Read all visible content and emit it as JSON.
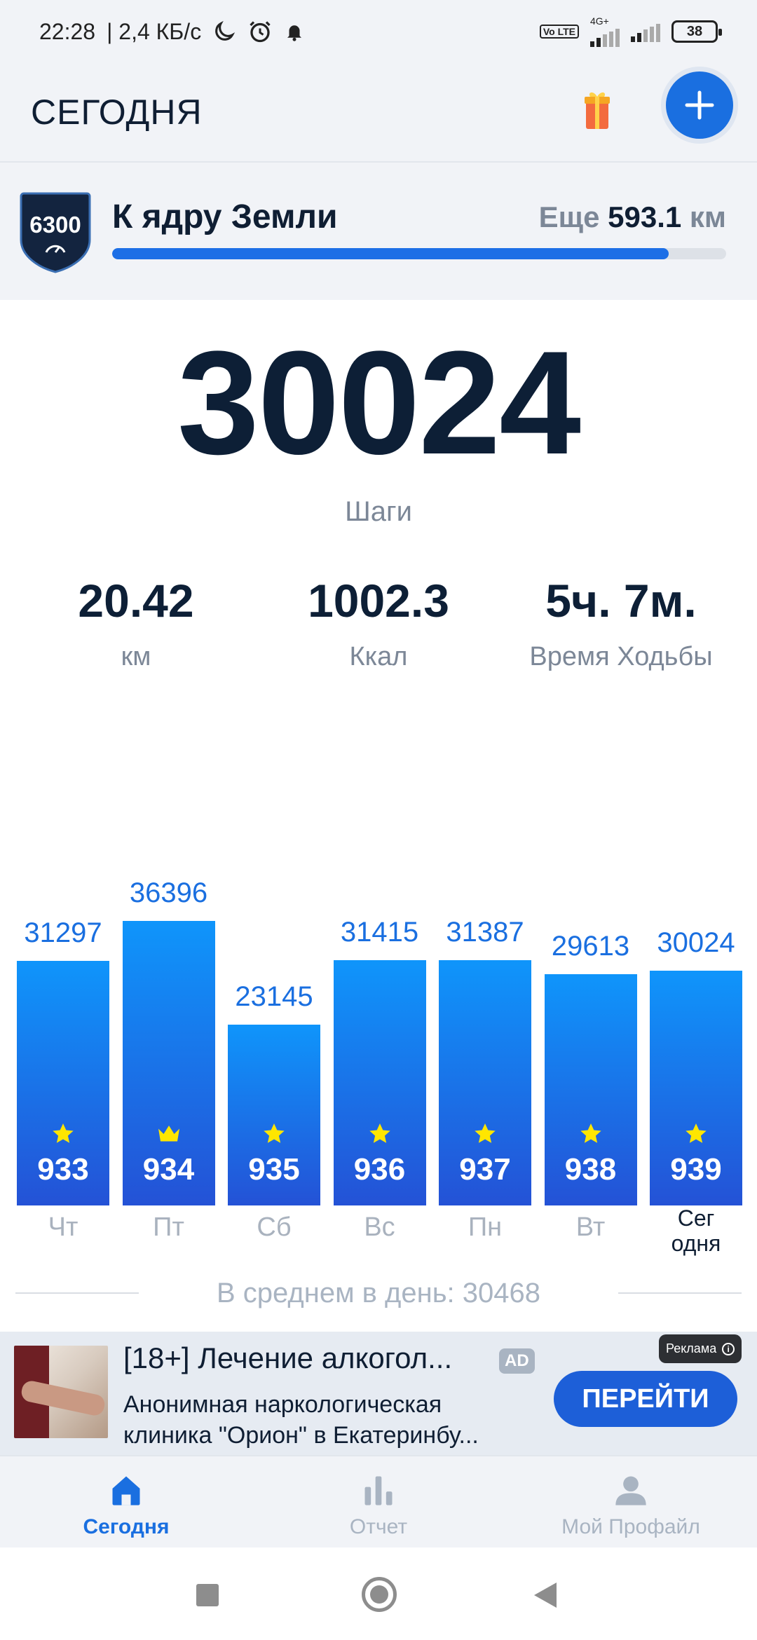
{
  "status_bar": {
    "time": "22:28",
    "network_speed": "| 2,4 КБ/с",
    "icons": [
      "moon-icon",
      "alarm-icon",
      "bell-icon",
      "volte-icon",
      "signal-icon",
      "battery-icon"
    ],
    "volte_label": "Vo LTE",
    "network_type": "4G+",
    "battery": "38"
  },
  "header": {
    "title": "СЕГОДНЯ",
    "icons": [
      "gift-icon",
      "plus-icon"
    ]
  },
  "goal": {
    "badge_number": "6300",
    "title": "К ядру Земли",
    "remaining_prefix": "Еще",
    "remaining_value": "593.1",
    "remaining_unit": "км",
    "progress_fraction": 0.906
  },
  "today": {
    "steps": "30024",
    "steps_label": "Шаги",
    "distance": "20.42",
    "distance_unit": "км",
    "calories": "1002.3",
    "calories_unit": "Ккал",
    "walk_time": "5ч. 7м.",
    "walk_time_label": "Время Ходьбы"
  },
  "chart_data": {
    "type": "bar",
    "categories": [
      "Чт",
      "Пт",
      "Сб",
      "Вс",
      "Пн",
      "Вт",
      "Сег одня"
    ],
    "values": [
      31297,
      36396,
      23145,
      31415,
      31387,
      29613,
      30024
    ],
    "day_numbers": [
      "933",
      "934",
      "935",
      "936",
      "937",
      "938",
      "939"
    ],
    "day_icons": [
      "star-icon",
      "crown-icon",
      "star-icon",
      "star-icon",
      "star-icon",
      "star-icon",
      "star-icon"
    ],
    "today_index": 6,
    "colors": {
      "bar_top": "#0f95fb",
      "bar_bottom": "#2452d6",
      "value_label": "#1a6fe0",
      "star": "#ffe600"
    }
  },
  "average": {
    "text": "В среднем в день: 30468"
  },
  "ad": {
    "title": "[18+] Лечение алкогол...",
    "tag": "AD",
    "description_line1": "Анонимная наркологическая",
    "description_line2": "клиника \"Орион\" в Екатеринбу...",
    "label": "Реклама",
    "cta": "ПЕРЕЙТИ"
  },
  "bottom_nav": {
    "items": [
      {
        "label": "Сегодня",
        "icon": "home-icon",
        "active": true
      },
      {
        "label": "Отчет",
        "icon": "bar-chart-icon",
        "active": false
      },
      {
        "label": "Мой Профайл",
        "icon": "profile-icon",
        "active": false
      }
    ]
  },
  "colors": {
    "accent": "#1a6fe0",
    "text_dark": "#0d1f36",
    "text_muted": "#7c8797",
    "surface": "#f1f3f7"
  }
}
